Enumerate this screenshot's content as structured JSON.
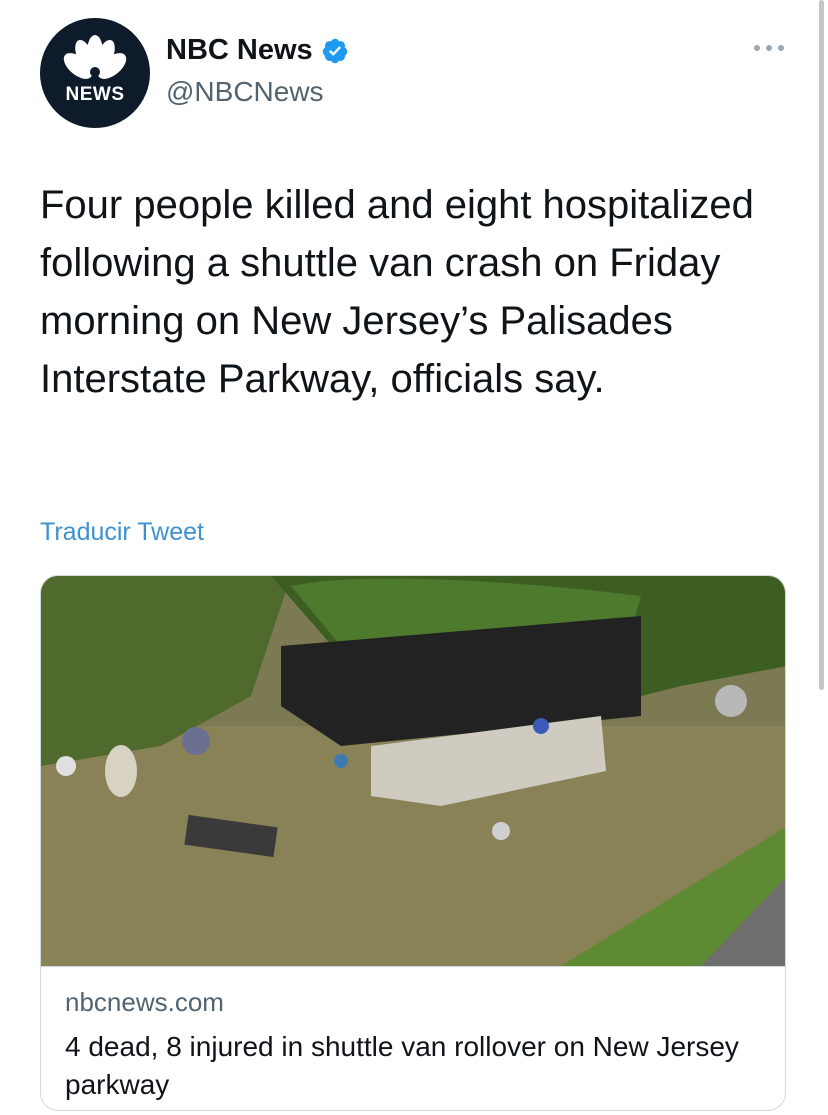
{
  "account": {
    "display_name": "NBC News",
    "handle": "@NBCNews",
    "avatar_text": "NEWS",
    "verified": true
  },
  "tweet": {
    "text": "Four people killed and eight hospitalized following a shuttle van crash on Friday morning on New Jersey’s Palisades Interstate Parkway, officials say.",
    "translate_label": "Traducir Tweet"
  },
  "card": {
    "domain": "nbcnews.com",
    "title": "4 dead, 8 injured in shuttle van rollover on New Jersey parkway"
  },
  "colors": {
    "link": "#3b91d1",
    "verified": "#1d9bf0",
    "avatar_bg": "#0d1b2a"
  },
  "icons": {
    "more": "more-options-icon",
    "verified": "verified-badge-icon",
    "logo": "nbc-peacock-icon"
  }
}
